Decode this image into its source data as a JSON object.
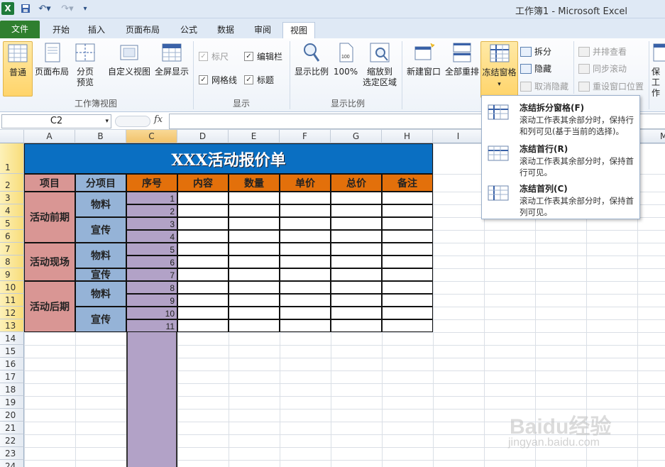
{
  "window": {
    "title": "工作簿1 - Microsoft Excel"
  },
  "tabs": [
    {
      "label": "文件"
    },
    {
      "label": "开始"
    },
    {
      "label": "插入"
    },
    {
      "label": "页面布局"
    },
    {
      "label": "公式"
    },
    {
      "label": "数据"
    },
    {
      "label": "审阅"
    },
    {
      "label": "视图"
    }
  ],
  "active_tab": "视图",
  "ribbon": {
    "workbook_views": {
      "label": "工作簿视图",
      "normal": "普通",
      "page_layout": "页面布局",
      "page_break_1": "分页",
      "page_break_2": "预览",
      "custom_view": "自定义视图",
      "full_screen": "全屏显示"
    },
    "show": {
      "label": "显示",
      "ruler": "标尺",
      "formula_bar": "编辑栏",
      "gridlines": "网格线",
      "headings": "标题"
    },
    "zoom": {
      "label": "显示比例",
      "zoom": "显示比例",
      "zoom100": "100%",
      "zoom_sel_1": "缩放到",
      "zoom_sel_2": "选定区域",
      "icon_text": "100"
    },
    "window": {
      "new_window": "新建窗口",
      "arrange_all": "全部重排",
      "freeze_panes": "冻结窗格",
      "split": "拆分",
      "hide": "隐藏",
      "unhide": "取消隐藏",
      "side_by_side": "并排查看",
      "sync_scroll": "同步滚动",
      "reset_pos": "重设窗口位置",
      "save_ws_1": "保",
      "save_ws_2": "工作"
    }
  },
  "formula_bar": {
    "name_box": "C2",
    "fx": "fx",
    "value": ""
  },
  "columns": [
    "A",
    "B",
    "C",
    "D",
    "E",
    "F",
    "G",
    "H",
    "I",
    "M"
  ],
  "rows": [
    "1",
    "2",
    "3",
    "4",
    "5",
    "6",
    "7",
    "8",
    "9",
    "10",
    "11",
    "12",
    "13",
    "14",
    "15",
    "16",
    "17",
    "18",
    "19",
    "20",
    "21",
    "22",
    "23",
    "24"
  ],
  "sheet": {
    "title": "XXX活动报价单",
    "headers": [
      "项目",
      "分项目",
      "序号",
      "内容",
      "数量",
      "单价",
      "总价",
      "备注"
    ],
    "projects": [
      "活动前期",
      "活动现场",
      "活动后期"
    ],
    "subitems": [
      "物料",
      "宣传",
      "物料",
      "宣传",
      "物料",
      "宣传"
    ],
    "seq": [
      "1",
      "2",
      "3",
      "4",
      "5",
      "6",
      "7",
      "8",
      "9",
      "10",
      "11"
    ]
  },
  "dropdown": {
    "items": [
      {
        "title": "冻结拆分窗格(F)",
        "desc": "滚动工作表其余部分时，保持行和列可见(基于当前的选择)。"
      },
      {
        "title": "冻结首行(R)",
        "desc": "滚动工作表其余部分时，保持首行可见。"
      },
      {
        "title": "冻结首列(C)",
        "desc": "滚动工作表其余部分时，保持首列可见。"
      }
    ]
  },
  "watermark": {
    "brand": "Baidu经验",
    "url": "jingyan.baidu.com"
  },
  "colors": {
    "title_blue": "#0a6fc2",
    "header_orange": "#e3700b",
    "project_pink": "#d99694",
    "subitem_blue": "#95b3d7",
    "seq_purple": "#b2a2c7"
  }
}
